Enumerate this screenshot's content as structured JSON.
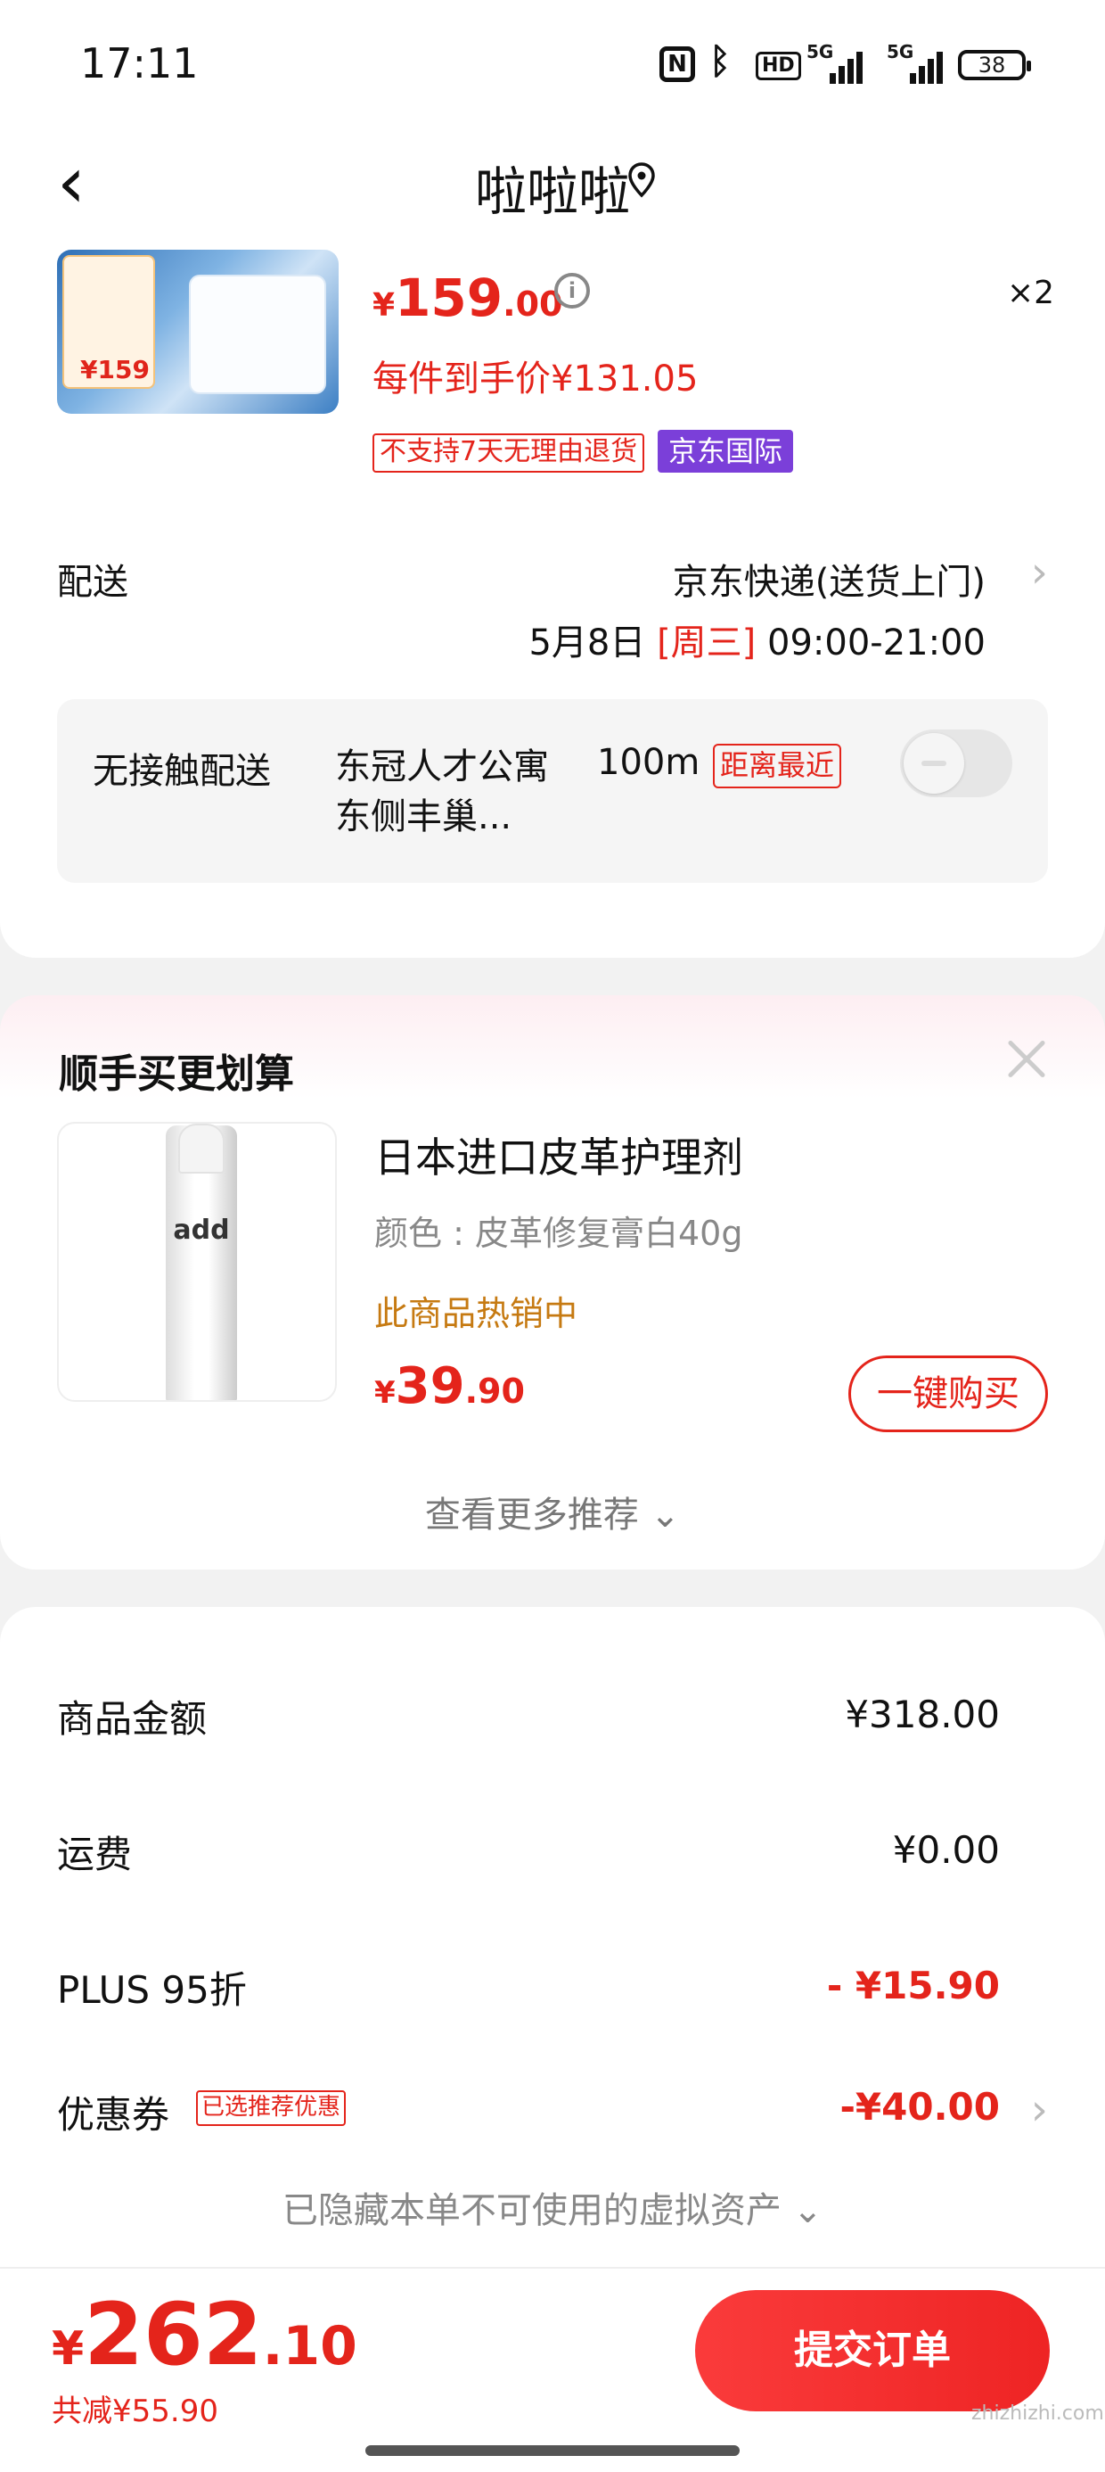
{
  "status_bar": {
    "time": "17:11",
    "battery": "38",
    "network": "5G"
  },
  "header": {
    "title": "啦啦啦"
  },
  "product": {
    "thumb_price": "159",
    "price_currency": "¥",
    "price_int": "159",
    "price_dec": ".00",
    "quantity": "×2",
    "unit_price": "每件到手价¥131.05",
    "tag_return": "不支持7天无理由退货",
    "tag_global": "京东国际"
  },
  "delivery": {
    "label": "配送",
    "method": "京东快递(送货上门)",
    "date": "5月8日 ",
    "weekday": "[周三]",
    "time": " 09:00-21:00",
    "contactless_label": "无接触配送",
    "pickup_name": "东冠人才公寓东侧丰巢...",
    "pickup_distance": "100m",
    "nearest_tag": "距离最近"
  },
  "upsell": {
    "title": "顺手买更划算",
    "product_name": "日本进口皮革护理剂",
    "spec": "颜色 : 皮革修复膏白40g",
    "hot": "此商品热销中",
    "thumb_label": "add",
    "price_currency": "¥",
    "price_int": "39",
    "price_dec": ".90",
    "buy_label": "一键购买",
    "more_label": "查看更多推荐 ⌄"
  },
  "totals": {
    "rows": [
      {
        "label": "商品金额",
        "value": "¥318.00"
      },
      {
        "label": "运费",
        "value": "¥0.00"
      },
      {
        "label": "PLUS 95折",
        "value": "- ¥15.90"
      },
      {
        "label": "优惠券",
        "value": "-¥40.00"
      }
    ],
    "coupon_tag": "已选推荐优惠",
    "hidden_note": "已隐藏本单不可使用的虚拟资产 ⌄"
  },
  "bottom_bar": {
    "total_currency": "¥",
    "total_int": "262",
    "total_dec": ".10",
    "saved": "共减¥55.90",
    "submit_label": "提交订单",
    "watermark": "zhizhizhi.com"
  },
  "colors": {
    "accent": "#e4241b",
    "global_tag": "#7b3fd9",
    "hot": "#c67a12"
  }
}
